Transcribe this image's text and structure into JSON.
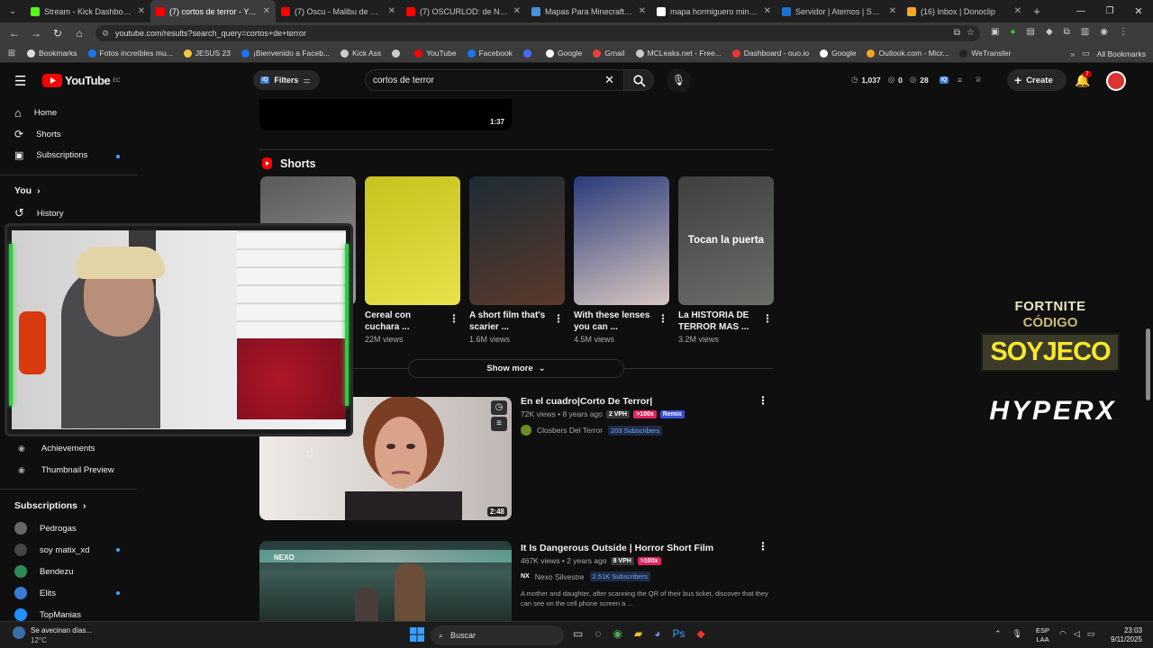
{
  "tabs": [
    {
      "title": "Stream - Kick Dashboard",
      "color": "#53fc18"
    },
    {
      "title": "(7) cortos de terror - YouT",
      "color": "#ff0000",
      "active": true
    },
    {
      "title": "(7) Oscu - Malibu de Coc",
      "color": "#ff0000"
    },
    {
      "title": "(7) OSCURLOD: de Niño fi",
      "color": "#ff0000"
    },
    {
      "title": "Mapas Para Minecraft - Z",
      "color": "#4a90d9"
    },
    {
      "title": "mapa hormiguero minecr",
      "color": "#ffffff"
    },
    {
      "title": "Servidor | Aternos | Servi",
      "color": "#1f6fd0"
    },
    {
      "title": "(16) Inbox | Donoclip",
      "color": "#f5a623"
    }
  ],
  "url": "youtube.com/results?search_query=cortos+de+terror",
  "bookmarks": [
    {
      "label": "Bookmarks",
      "color": "#ddd"
    },
    {
      "label": "Fotos increíbles mu...",
      "color": "#1877f2"
    },
    {
      "label": "JESUS 23",
      "color": "#f5c542"
    },
    {
      "label": "¡Bienvenido a Faceb...",
      "color": "#1877f2"
    },
    {
      "label": "Kick Ass",
      "color": "#ccc"
    },
    {
      "label": "",
      "color": "#ccc"
    },
    {
      "label": "YouTube",
      "color": "#ff0000"
    },
    {
      "label": "Facebook",
      "color": "#1877f2"
    },
    {
      "label": "",
      "color": "#4a6cf7"
    },
    {
      "label": "Google",
      "color": "#fff"
    },
    {
      "label": "Gmail",
      "color": "#ea4335"
    },
    {
      "label": "MCLeaks.net - Free...",
      "color": "#ccc"
    },
    {
      "label": "Dashboard - ouo.io",
      "color": "#e33"
    },
    {
      "label": "Google",
      "color": "#fff"
    },
    {
      "label": "Outlook.com - Micr...",
      "color": "#f5a623"
    },
    {
      "label": "WeTransfer",
      "color": "#222"
    }
  ],
  "all_bookmarks": "All Bookmarks",
  "yt": {
    "logo_text": "YouTube",
    "logo_sup": "EC",
    "filters": "Filters",
    "search_value": "cortos de terror",
    "stats": [
      "1,037",
      "0",
      "28"
    ],
    "create": "Create",
    "notif_count": "7"
  },
  "sidebar": {
    "home": "Home",
    "shorts": "Shorts",
    "subscriptions": "Subscriptions",
    "you": "You",
    "history": "History",
    "achievements": "Achievements",
    "thumb_preview": "Thumbnail Preview",
    "subs_header": "Subscriptions",
    "subs": [
      {
        "name": "Pedrogas",
        "color": "#666",
        "dot": false
      },
      {
        "name": "soy matix_xd",
        "color": "#444",
        "dot": true
      },
      {
        "name": "Bendezu",
        "color": "#2e8b57",
        "dot": false
      },
      {
        "name": "Elits",
        "color": "#3a7bd5",
        "dot": true
      },
      {
        "name": "TopManias",
        "color": "#1e90ff",
        "dot": false
      }
    ]
  },
  "prev_video_duration": "1:37",
  "shorts_header": "Shorts",
  "shorts": [
    {
      "title": "",
      "views": "",
      "colors": [
        "#5a5a5a",
        "#9a9a9a"
      ]
    },
    {
      "title": "Cereal con cuchara ...",
      "views": "22M views",
      "colors": [
        "#c6c21e",
        "#e7e24a"
      ]
    },
    {
      "title": "A short film that's scarier ...",
      "views": "1.6M views",
      "colors": [
        "#1d2c35",
        "#5b3a2c"
      ]
    },
    {
      "title": "With these lenses you can ...",
      "views": "4.5M views",
      "colors": [
        "#2a3b7a",
        "#d7c6c0"
      ]
    },
    {
      "title": "La HISTORIA DE TERROR MAS ...",
      "views": "3.2M views",
      "colors": [
        "#3e403d",
        "#6c6e6a"
      ],
      "overlay": "Tocan la puerta"
    }
  ],
  "show_more": "Show more",
  "videos": [
    {
      "title": "En el cuadro|Corto De Terror|",
      "views": "72K views",
      "age": "8 years ago",
      "vph": "2 VPH",
      "badge2": ">100x",
      "badge3": "Remix",
      "channel": "Closbers Del Terror",
      "subs": "203 Subscribers",
      "duration": "2:48",
      "description": ""
    },
    {
      "title": "It Is Dangerous Outside | Horror Short Film",
      "views": "467K views",
      "age": "2 years ago",
      "vph": "8 VPH",
      "badge2": ">100x",
      "channel": "Nexo Silvestre",
      "subs": "2.51K Subscribers",
      "description": "A mother and daughter, after scanning the QR of their bus ticket, discover that they can see on the cell phone screen a ...",
      "duration": ""
    }
  ],
  "promo": {
    "line1": "FORTNITE",
    "line2": "CÓDIGO",
    "line3": "SOYJECO",
    "brand": "HYPERX"
  },
  "taskbar": {
    "weather_title": "Se avecinan días...",
    "weather_temp": "12°C",
    "search": "Buscar",
    "lang1": "ESP",
    "lang2": "LAA",
    "time": "23:03",
    "date": "9/11/2025"
  }
}
